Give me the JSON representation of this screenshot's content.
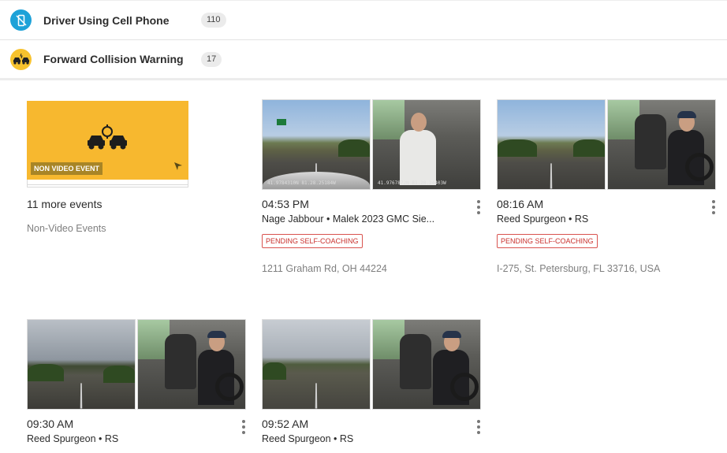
{
  "categories": [
    {
      "label": "Driver Using Cell Phone",
      "count": "110",
      "icon": "phone-off-icon",
      "color": "#1ea2d8"
    },
    {
      "label": "Forward Collision Warning",
      "count": "17",
      "icon": "collision-icon",
      "color": "#f7c22e"
    }
  ],
  "non_video": {
    "badge": "NON VIDEO EVENT",
    "title": "11 more events",
    "subtitle": "Non-Video Events",
    "card_color": "#f7b82f"
  },
  "events": [
    {
      "time": "04:53 PM",
      "driver": "Nage Jabbour • Malek 2023 GMC Sie...",
      "status": "PENDING SELF-COACHING",
      "location": "1211 Graham Rd, OH 44224",
      "gps_left": "41.9784310N 81.28.25184W",
      "gps_right": "41.9767872N 81.28.24403W"
    },
    {
      "time": "08:16 AM",
      "driver": "Reed Spurgeon • RS",
      "status": "PENDING SELF-COACHING",
      "location": "I-275, St. Petersburg, FL 33716, USA"
    },
    {
      "time": "09:30 AM",
      "driver": "Reed Spurgeon • RS"
    },
    {
      "time": "09:52 AM",
      "driver": "Reed Spurgeon • RS"
    }
  ]
}
